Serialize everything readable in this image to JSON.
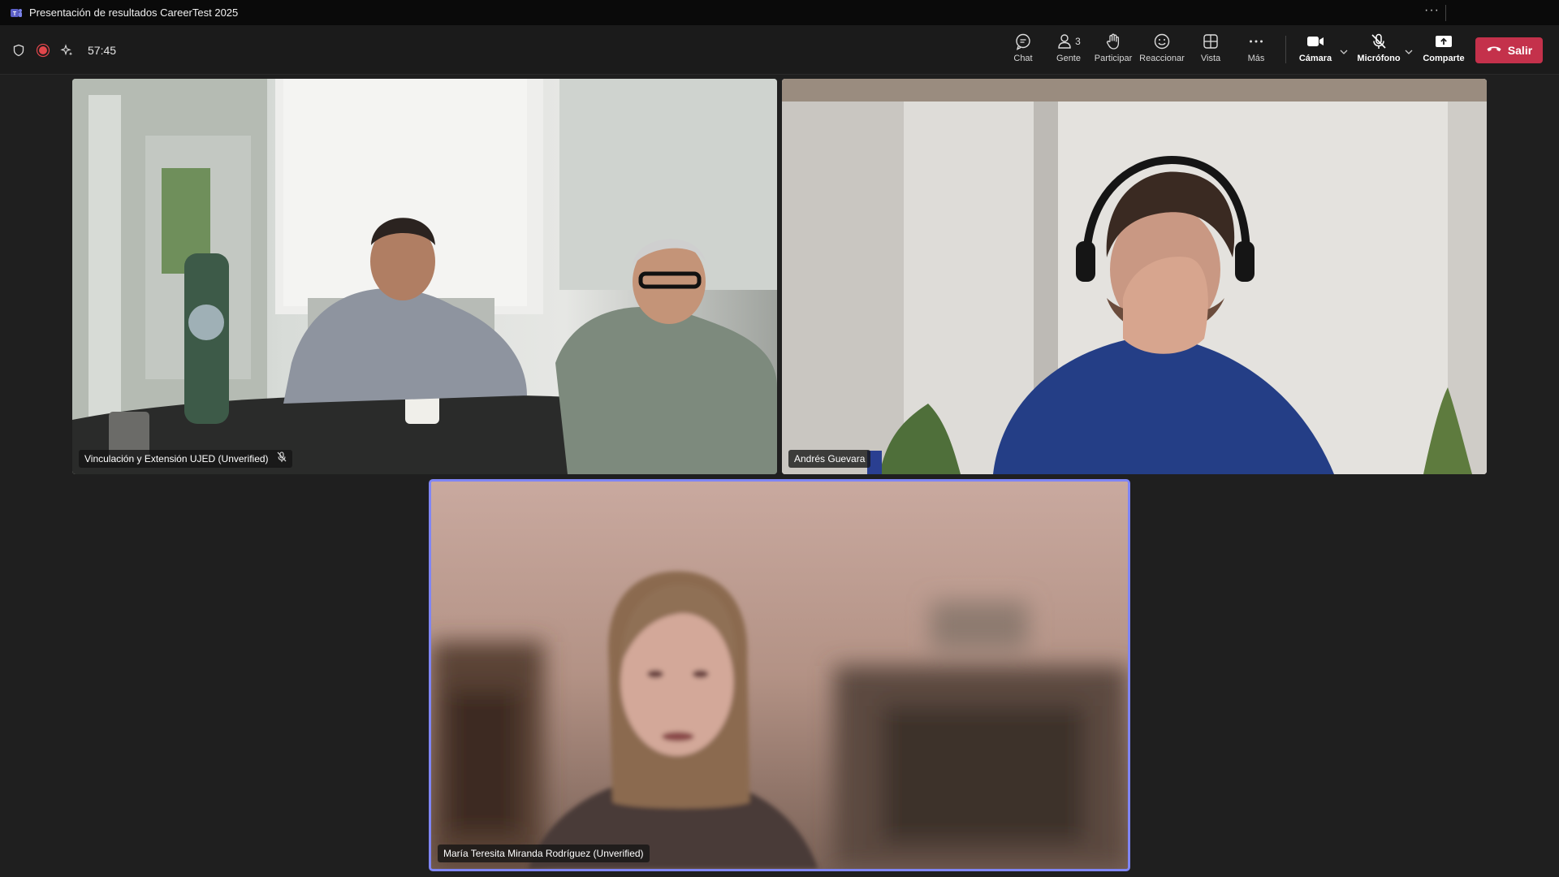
{
  "window": {
    "title": "Presentación de resultados CareerTest 2025",
    "more_glyph": "···"
  },
  "toolbar": {
    "timer": "57:45",
    "chat_label": "Chat",
    "people_label": "Gente",
    "people_count": "3",
    "raise_label": "Participar",
    "react_label": "Reaccionar",
    "view_label": "Vista",
    "more_label": "Más",
    "camera_label": "Cámara",
    "mic_label": "Micrófono",
    "share_label": "Comparte",
    "leave_label": "Salir"
  },
  "participants": [
    {
      "name": "Vinculación y Extensión UJED (Unverified)",
      "muted": true
    },
    {
      "name": "Andrés Guevara",
      "muted": false
    },
    {
      "name": "María Teresita Miranda Rodríguez (Unverified)",
      "muted": false,
      "speaking": true
    }
  ],
  "colors": {
    "leave": "#c4314b",
    "active_speaker_border": "#7f85f5",
    "recording": "#e0464b"
  }
}
